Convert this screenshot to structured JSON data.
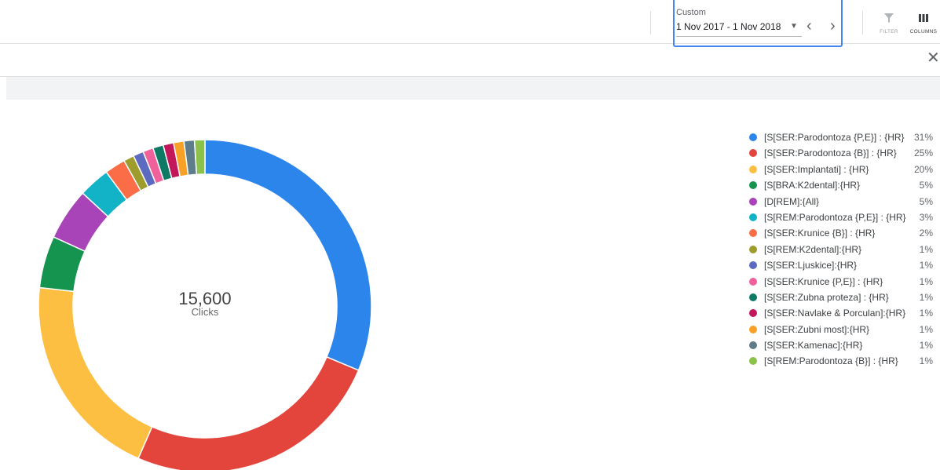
{
  "toolbar": {
    "date_range_label": "Custom",
    "date_range_value": "1 Nov 2017 - 1 Nov 2018",
    "filter_label": "FILTER",
    "columns_label": "COLUMNS"
  },
  "chart_data": {
    "type": "pie",
    "center_value": "15,600",
    "center_label": "Clicks",
    "legend_position": "right",
    "slices": [
      {
        "name": "[S[SER:Parodontoza {P,E}] : {HR}",
        "pct_label": "31%",
        "value": 31,
        "color": "#2b85ea"
      },
      {
        "name": "[S[SER:Parodontoza {B}] : {HR}",
        "pct_label": "25%",
        "value": 25,
        "color": "#e3443c"
      },
      {
        "name": "[S[SER:Implantati] : {HR}",
        "pct_label": "20%",
        "value": 20,
        "color": "#fdbf42"
      },
      {
        "name": "[S[BRA:K2dental]:{HR}",
        "pct_label": "5%",
        "value": 5,
        "color": "#15944f"
      },
      {
        "name": "[D[REM]:{All}",
        "pct_label": "5%",
        "value": 5,
        "color": "#a944b8"
      },
      {
        "name": "[S[REM:Parodontoza {P,E}] : {HR}",
        "pct_label": "3%",
        "value": 3,
        "color": "#12b3c6"
      },
      {
        "name": "[S[SER:Krunice {B}] : {HR}",
        "pct_label": "2%",
        "value": 2,
        "color": "#fb6d47"
      },
      {
        "name": "[S[REM:K2dental]:{HR}",
        "pct_label": "1%",
        "value": 1,
        "color": "#9f9c2e"
      },
      {
        "name": "[S[SER:Ljuskice]:{HR}",
        "pct_label": "1%",
        "value": 1,
        "color": "#5c6bc0"
      },
      {
        "name": "[S[SER:Krunice {P,E}] : {HR}",
        "pct_label": "1%",
        "value": 1,
        "color": "#f0609a"
      },
      {
        "name": "[S[SER:Zubna proteza] : {HR}",
        "pct_label": "1%",
        "value": 1,
        "color": "#0e7a65"
      },
      {
        "name": "[S[SER:Navlake & Porculan]:{HR}",
        "pct_label": "1%",
        "value": 1,
        "color": "#c2185b"
      },
      {
        "name": "[S[SER:Zubni most]:{HR}",
        "pct_label": "1%",
        "value": 1,
        "color": "#f9a026"
      },
      {
        "name": "[S[SER:Kamenac]:{HR}",
        "pct_label": "1%",
        "value": 1,
        "color": "#5f7c8a"
      },
      {
        "name": "[S[REM:Parodontoza {B}] : {HR}",
        "pct_label": "1%",
        "value": 1,
        "color": "#8bc34a"
      }
    ]
  }
}
